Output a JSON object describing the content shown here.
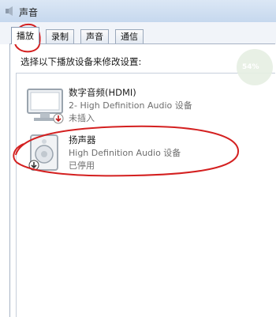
{
  "window": {
    "title": "声音",
    "icon": "speaker-icon"
  },
  "tabs": [
    {
      "label": "播放",
      "active": true
    },
    {
      "label": "录制",
      "active": false
    },
    {
      "label": "声音",
      "active": false
    },
    {
      "label": "通信",
      "active": false
    }
  ],
  "instruction": "选择以下播放设备来修改设置:",
  "devices": [
    {
      "name": "数字音频(HDMI)",
      "description": "2- High Definition Audio 设备",
      "status": "未插入",
      "icon": "monitor-icon",
      "status_icon": "unplugged-icon"
    },
    {
      "name": "扬声器",
      "description": "High Definition Audio 设备",
      "status": "已停用",
      "icon": "speaker-icon",
      "status_icon": "disabled-icon"
    }
  ],
  "badge": {
    "text": "54%"
  },
  "colors": {
    "annotation": "#d42020",
    "accent": "#c6d8ee"
  }
}
